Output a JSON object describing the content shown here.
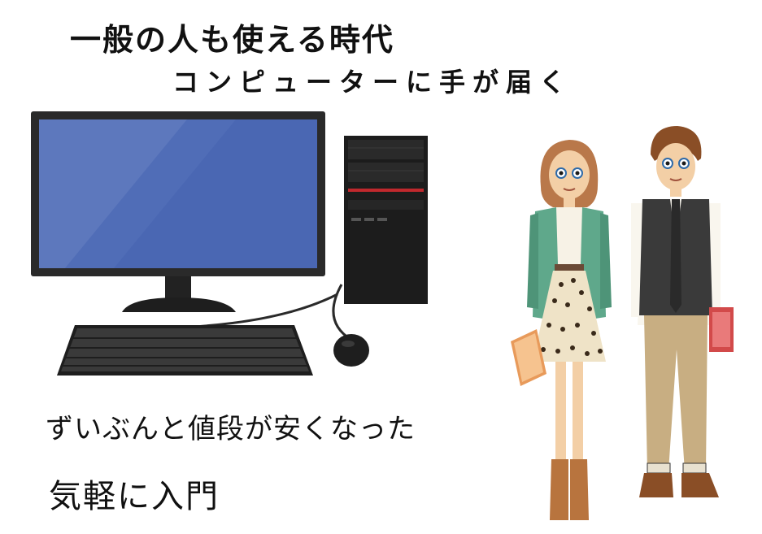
{
  "headline": {
    "line1": "一般の人も使える時代",
    "line2": "コンピューターに手が届く"
  },
  "captions": {
    "price": "ずいぶんと値段が安くなった",
    "easy": "気軽に入門"
  },
  "colors": {
    "monitor_screen": "#4a67b3",
    "monitor_frame": "#2a2a2a",
    "tower_accent": "#c0282d",
    "cardigan": "#5fa88b",
    "vest": "#3a3a3a",
    "pants": "#c8ae82"
  },
  "icons": {
    "computer": "desktop-computer-illustration",
    "people": "young-couple-illustration"
  }
}
